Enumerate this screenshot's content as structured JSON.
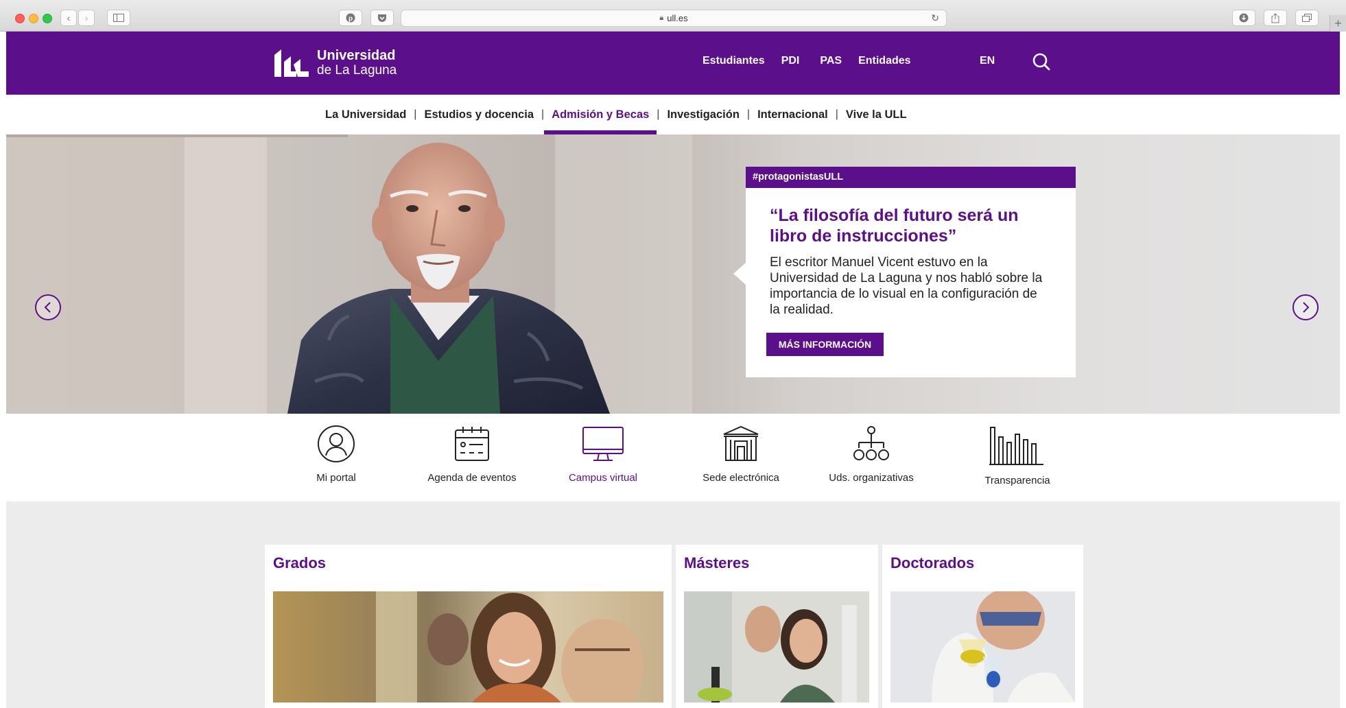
{
  "browser": {
    "url": "ull.es"
  },
  "header": {
    "logo_line1": "Universidad",
    "logo_line2": "de La Laguna",
    "audience_links": [
      "Estudiantes",
      "PDI",
      "PAS",
      "Entidades"
    ],
    "language": "EN"
  },
  "main_nav": {
    "items": [
      "La Universidad",
      "Estudios y docencia",
      "Admisión y Becas",
      "Investigación",
      "Internacional",
      "Vive la ULL"
    ],
    "active": "Admisión y Becas"
  },
  "hero": {
    "tag": "#protagonistasULL",
    "title": "“La filosofía del futuro será un libro de instrucciones”",
    "text": "El escritor Manuel Vicent estuvo en la Universidad de La Laguna y nos habló sobre la importancia de lo visual en la configuración de la realidad.",
    "button": "MÁS INFORMACIÓN"
  },
  "quick_links": {
    "items": [
      "Mi portal",
      "Agenda de eventos",
      "Campus virtual",
      "Sede electrónica",
      "Uds. organizativas",
      "Transparencia"
    ],
    "active": "Campus virtual"
  },
  "study_cards": [
    "Grados",
    "Másteres",
    "Doctorados"
  ],
  "colors": {
    "brand_purple": "#5c0f8b",
    "page_background": "#ececec"
  }
}
